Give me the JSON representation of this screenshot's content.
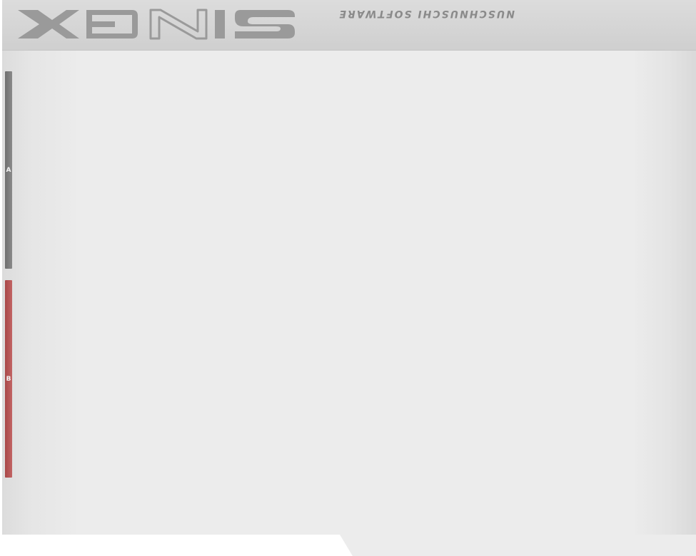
{
  "header": {
    "logo_text": "SINGX",
    "tagline": "NUSCHNUSCHI SOFTWARE"
  },
  "decks": [
    {
      "label": "A",
      "color": "#7d7d7d"
    },
    {
      "label": "B",
      "color": "#b85858"
    }
  ],
  "colors": {
    "background": "#ececec",
    "header": "#d4d4d4",
    "logo": "#9a9a9a",
    "tagline": "#8a8a8a"
  }
}
